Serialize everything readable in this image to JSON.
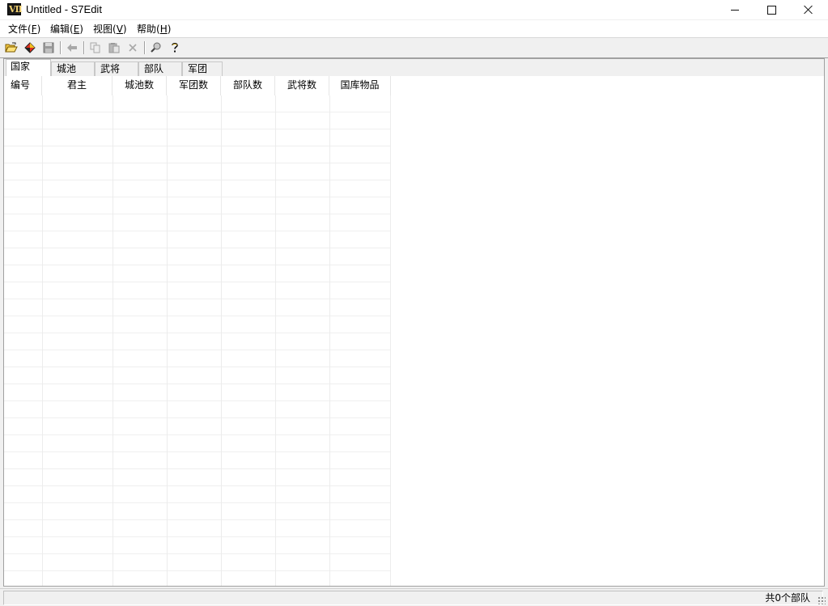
{
  "window": {
    "title": "Untitled - S7Edit",
    "icon": "app-icon-vii"
  },
  "menu": {
    "items": [
      {
        "label": "文件(",
        "key": "F",
        "end": ")"
      },
      {
        "label": "编辑(",
        "key": "E",
        "end": ")"
      },
      {
        "label": "视图(",
        "key": "V",
        "end": ")"
      },
      {
        "label": "帮助(",
        "key": "H",
        "end": ")"
      }
    ]
  },
  "toolbar": {
    "buttons": [
      "open-folder-icon",
      "load-icon",
      "save-icon",
      "back-icon",
      "copy-icon",
      "paste-icon",
      "delete-icon",
      "find-icon",
      "help-icon"
    ]
  },
  "tabs": [
    {
      "label": "国家",
      "active": true
    },
    {
      "label": "城池",
      "active": false
    },
    {
      "label": "武将",
      "active": false
    },
    {
      "label": "部队",
      "active": false
    },
    {
      "label": "军团",
      "active": false
    }
  ],
  "table": {
    "columns": [
      "编号",
      "君主",
      "城池数",
      "军团数",
      "部队数",
      "武将数",
      "国库物品"
    ],
    "rows": []
  },
  "status": {
    "text": "共0个部队"
  },
  "colors": {
    "chrome": "#f0f0f0",
    "content": "#ffffff",
    "gridline": "#efefef"
  }
}
